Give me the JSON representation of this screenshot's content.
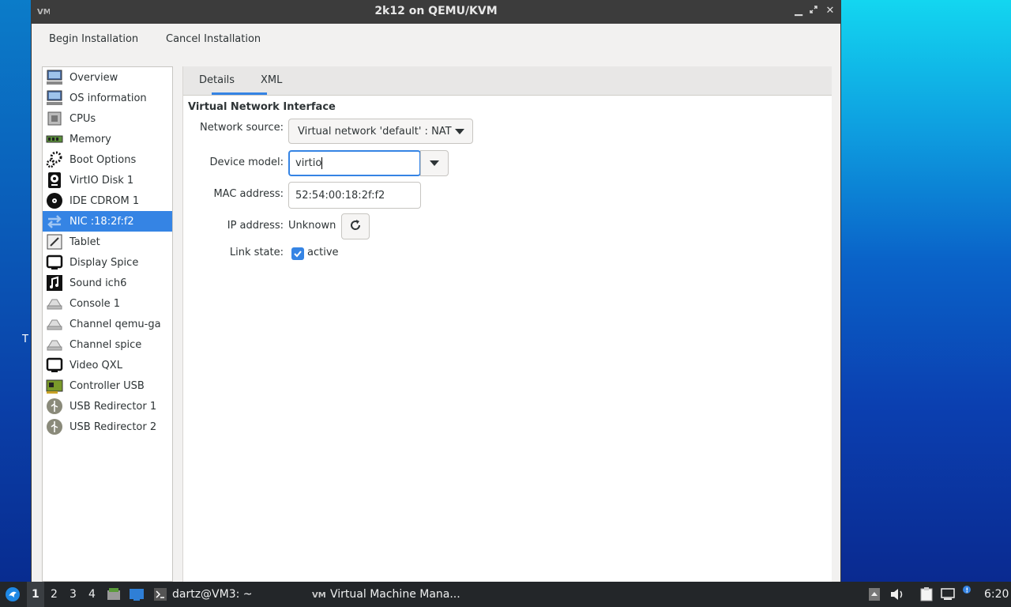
{
  "window": {
    "title": "2k12 on QEMU/KVM",
    "controls": [
      "minimize",
      "restore",
      "close"
    ]
  },
  "toolbar": {
    "begin_label": "Begin Installation",
    "cancel_label": "Cancel Installation"
  },
  "sidebar": {
    "items": [
      {
        "label": "Overview",
        "icon": "monitor-icon"
      },
      {
        "label": "OS information",
        "icon": "monitor-info-icon"
      },
      {
        "label": "CPUs",
        "icon": "cpu-chip-icon"
      },
      {
        "label": "Memory",
        "icon": "memory-icon"
      },
      {
        "label": "Boot Options",
        "icon": "gears-icon"
      },
      {
        "label": "VirtIO Disk 1",
        "icon": "disk-icon"
      },
      {
        "label": "IDE CDROM 1",
        "icon": "cdrom-icon"
      },
      {
        "label": "NIC :18:2f:f2",
        "icon": "network-arrows-icon",
        "selected": true
      },
      {
        "label": "Tablet",
        "icon": "tablet-icon"
      },
      {
        "label": "Display Spice",
        "icon": "display-icon"
      },
      {
        "label": "Sound ich6",
        "icon": "sound-icon"
      },
      {
        "label": "Console 1",
        "icon": "serial-icon"
      },
      {
        "label": "Channel qemu-ga",
        "icon": "serial-icon"
      },
      {
        "label": "Channel spice",
        "icon": "serial-icon"
      },
      {
        "label": "Video QXL",
        "icon": "display-icon"
      },
      {
        "label": "Controller USB",
        "icon": "controller-card-icon"
      },
      {
        "label": "USB Redirector 1",
        "icon": "usb-icon"
      },
      {
        "label": "USB Redirector 2",
        "icon": "usb-icon"
      }
    ]
  },
  "tabs": {
    "details": "Details",
    "xml": "XML",
    "active": "Details"
  },
  "details": {
    "section_title": "Virtual Network Interface",
    "network_source_label": "Network source:",
    "network_source_value": "Virtual network 'default' : NAT",
    "device_model_label": "Device model:",
    "device_model_value": "virtio",
    "mac_label": "MAC address:",
    "mac_value": "52:54:00:18:2f:f2",
    "ip_label": "IP address:",
    "ip_value": "Unknown",
    "link_label": "Link state:",
    "link_value": "active",
    "link_checked": true
  },
  "desktop": {
    "stray_text": "T"
  },
  "taskbar": {
    "workspaces": [
      "1",
      "2",
      "3",
      "4"
    ],
    "active_workspace": "1",
    "terminal_task": "dartz@VM3: ~",
    "vmm_task": "Virtual Machine Mana...",
    "clock": "6:20"
  },
  "colors": {
    "accent": "#3584e4",
    "titlebar": "#3c3c3c",
    "taskbar": "#232629"
  }
}
